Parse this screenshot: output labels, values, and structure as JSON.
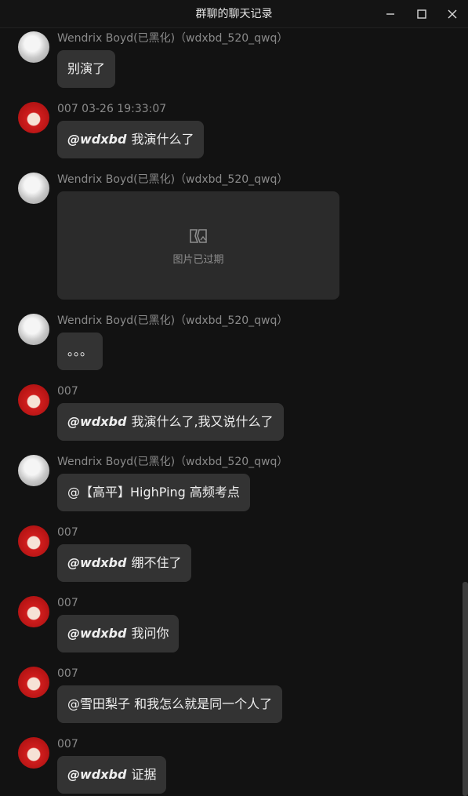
{
  "window": {
    "title": "群聊的聊天记录"
  },
  "messages": [
    {
      "sender": "Wendrix Boyd(已黑化)（wdxbd_520_qwq）",
      "mention": "",
      "text": "别演了"
    },
    {
      "sender": "007 03-26 19:33:07",
      "mention": "@wdxbd",
      "text": "我演什么了"
    },
    {
      "sender": "Wendrix Boyd(已黑化)（wdxbd_520_qwq）",
      "image_expired": "图片已过期"
    },
    {
      "sender": "Wendrix Boyd(已黑化)（wdxbd_520_qwq）",
      "mention": "",
      "text": "。。。"
    },
    {
      "sender": "007",
      "mention": "@wdxbd",
      "text": "我演什么了,我又说什么了"
    },
    {
      "sender": "Wendrix Boyd(已黑化)（wdxbd_520_qwq）",
      "mention": "",
      "text": "@【高平】HighPing 高频考点"
    },
    {
      "sender": "007",
      "mention": "@wdxbd",
      "text": "绷不住了"
    },
    {
      "sender": "007",
      "mention": "@wdxbd",
      "text": "我问你"
    },
    {
      "sender": "007",
      "mention": "",
      "text": "@雪田梨子 和我怎么就是同一个人了"
    },
    {
      "sender": "007",
      "mention": "@wdxbd",
      "text": "证据"
    }
  ]
}
